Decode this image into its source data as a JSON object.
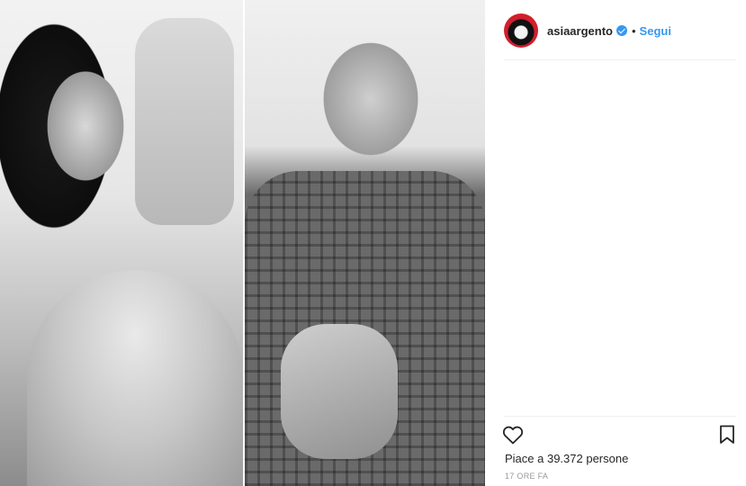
{
  "post": {
    "username": "asiaargento",
    "follow_label": "Segui",
    "separator": "•",
    "likes_text": "Piace a 39.372 persone",
    "timestamp": "17 ORE FA"
  },
  "icons": {
    "verified": "verified-badge-icon",
    "like": "heart-icon",
    "save": "bookmark-icon"
  },
  "colors": {
    "link": "#3897f0",
    "text": "#262626",
    "muted": "#999999",
    "avatar_ring": "#d11f2d"
  }
}
